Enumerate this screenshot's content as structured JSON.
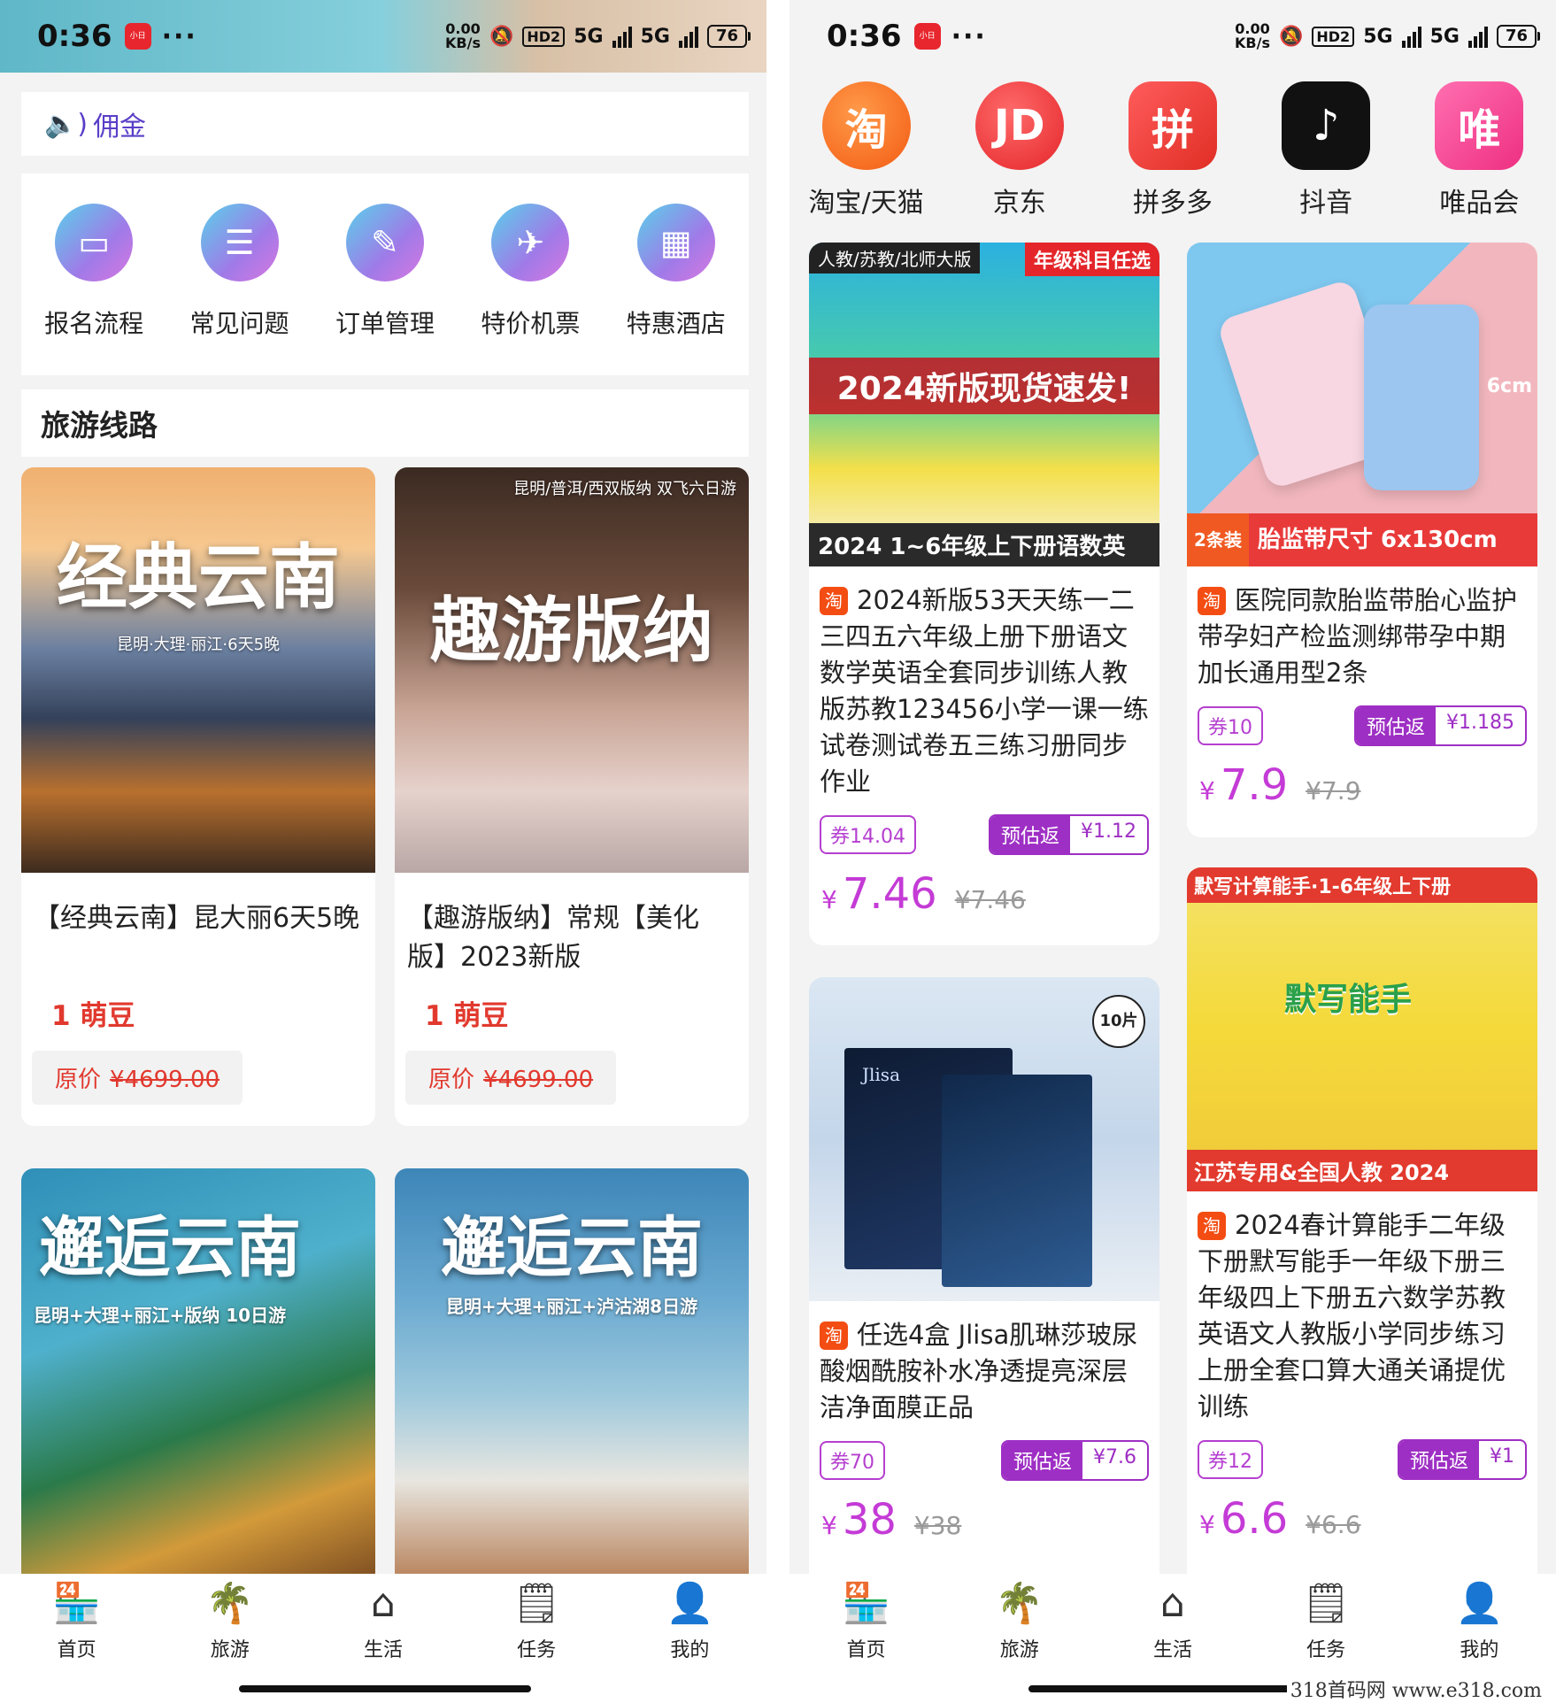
{
  "left": {
    "status": {
      "time": "0:36",
      "app_badge": "小日",
      "dots": "···",
      "speed_top": "0.00",
      "speed_bottom": "KB/s",
      "hd": "HD2",
      "net1": "5G",
      "net2": "5G",
      "battery": "76"
    },
    "notice": {
      "text": "佣金"
    },
    "quick_icons": [
      {
        "label": "报名流程",
        "icon": "book-icon"
      },
      {
        "label": "常见问题",
        "icon": "sliders-icon"
      },
      {
        "label": "订单管理",
        "icon": "document-edit-icon"
      },
      {
        "label": "特价机票",
        "icon": "airplane-icon"
      },
      {
        "label": "特惠酒店",
        "icon": "hotel-icon"
      }
    ],
    "section_title": "旅游线路",
    "tours": [
      {
        "img_title": "经典云南",
        "img_sub": "昆明·大理·丽江·6天5晚",
        "title": "【经典云南】昆大丽6天5晚",
        "price": "1 萌豆",
        "orig_label": "原价",
        "orig_price": "¥4699.00"
      },
      {
        "img_title": "趣游版纳",
        "img_sub": "昆明/普洱/西双版纳 双飞六日游",
        "title": "【趣游版纳】常规【美化版】2023新版",
        "price": "1 萌豆",
        "orig_label": "原价",
        "orig_price": "¥4699.00"
      },
      {
        "img_title": "邂逅云南",
        "img_sub": "昆明+大理+丽江+版纳 10日游"
      },
      {
        "img_title": "邂逅云南",
        "img_sub": "昆明+大理+丽江+泸沽湖8日游"
      }
    ],
    "tabs": [
      {
        "label": "首页",
        "icon": "shop-icon",
        "active": false
      },
      {
        "label": "旅游",
        "icon": "palm-tree-icon",
        "active": true
      },
      {
        "label": "生活",
        "icon": "house-face-icon",
        "active": false
      },
      {
        "label": "任务",
        "icon": "task-clock-icon",
        "active": false
      },
      {
        "label": "我的",
        "icon": "user-icon",
        "active": false
      }
    ]
  },
  "right": {
    "status": {
      "time": "0:36",
      "app_badge": "小日",
      "dots": "···",
      "speed_top": "0.00",
      "speed_bottom": "KB/s",
      "hd": "HD2",
      "net1": "5G",
      "net2": "5G",
      "battery": "76"
    },
    "platforms": [
      {
        "label": "淘宝/天猫",
        "glyph": "淘",
        "color": "#f35b12"
      },
      {
        "label": "京东",
        "glyph": "JD",
        "color": "#e4262a"
      },
      {
        "label": "拼多多",
        "glyph": "拼",
        "color": "#e02e24"
      },
      {
        "label": "抖音",
        "glyph": "♪",
        "color": "#111111"
      },
      {
        "label": "唯品会",
        "glyph": "唯",
        "color": "#ee2f82"
      }
    ],
    "products": [
      {
        "img_top": "人教/苏教/北师大版",
        "img_tag": "年级科目任选",
        "img_main": "2024新版现货速发!",
        "img_bottom": "2024 1~6年级上下册语数英",
        "mark": "淘",
        "title": "2024新版53天天练一二三四五六年级上册下册语文数学英语全套同步训练人教版苏教123456小学一课一练试卷测试卷五三练习册同步作业",
        "coupon": "券14.04",
        "rebate_label": "预估返",
        "rebate": "¥1.12",
        "currency": "¥",
        "price": "7.46",
        "orig": "¥7.46"
      },
      {
        "img_side": "6cm",
        "img_badge": "2条装",
        "img_bottom": "胎监带尺寸 6x130cm",
        "mark": "淘",
        "title": "医院同款胎监带胎心监护带孕妇产检监测绑带孕中期加长通用型2条",
        "coupon": "券10",
        "rebate_label": "预估返",
        "rebate": "¥1.185",
        "currency": "¥",
        "price": "7.9",
        "orig": "¥7.9"
      },
      {
        "img_badge": "10片",
        "img_brand": "Jlisa",
        "mark": "淘",
        "title": "任选4盒 Jlisa肌琳莎玻尿酸烟酰胺补水净透提亮深层洁净面膜正品",
        "coupon": "券70",
        "rebate_label": "预估返",
        "rebate": "¥7.6",
        "currency": "¥",
        "price": "38",
        "orig": "¥38"
      },
      {
        "img_top": "默写计算能手·1-6年级上下册",
        "img_main": "默写能手",
        "img_bottom": "江苏专用&全国人教 2024",
        "mark": "淘",
        "title": "2024春计算能手二年级下册默写能手一年级下册三年级四上下册五六数学苏教英语文人教版小学同步练习上册全套口算大通关诵提优训练",
        "coupon": "券12",
        "rebate_label": "预估返",
        "rebate": "¥1",
        "currency": "¥",
        "price": "6.6",
        "orig": "¥6.6"
      }
    ],
    "tabs": [
      {
        "label": "首页",
        "icon": "shop-icon",
        "active": true
      },
      {
        "label": "旅游",
        "icon": "palm-tree-icon",
        "active": false
      },
      {
        "label": "生活",
        "icon": "house-face-icon",
        "active": false
      },
      {
        "label": "任务",
        "icon": "task-clock-icon",
        "active": false
      },
      {
        "label": "我的",
        "icon": "user-icon",
        "active": false
      }
    ]
  },
  "watermark": "318首码网 www.e318.com",
  "colors": {
    "accent_purple": "#9e2fc4",
    "price_red": "#e1392e",
    "tab_active": "#e8262d"
  }
}
